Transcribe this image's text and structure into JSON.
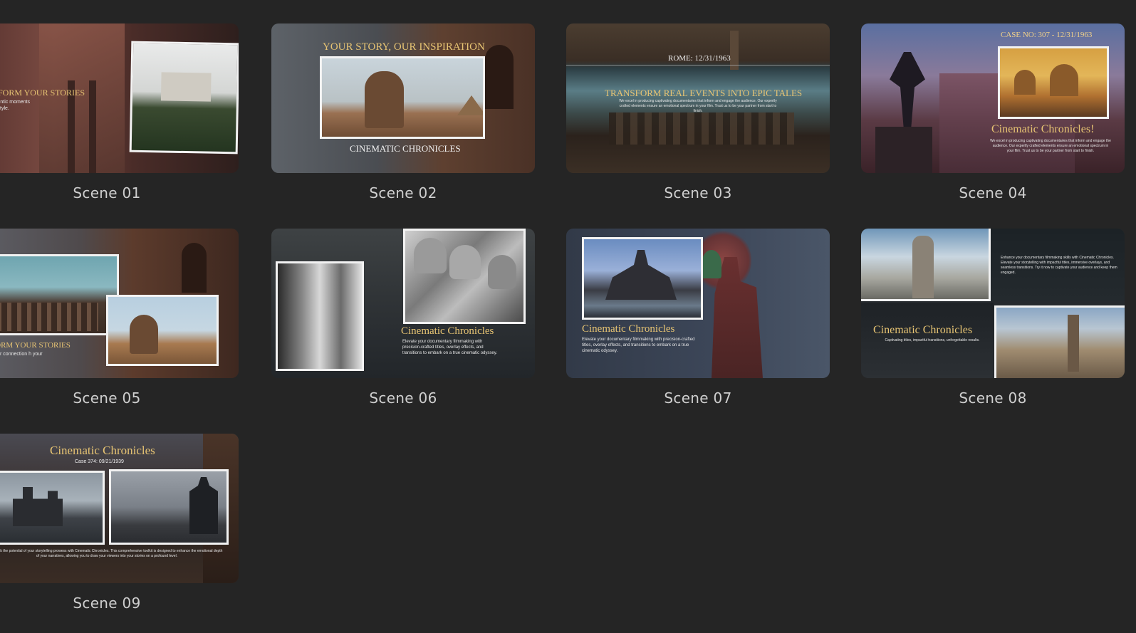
{
  "scenes": [
    {
      "label": "Scene 01",
      "heading": "RANSFORM YOUR STORIES",
      "body": "pture authentic moments cinematic style."
    },
    {
      "label": "Scene 02",
      "heading": "YOUR STORY, OUR INSPIRATION",
      "caption": "CINEMATIC CHRONICLES"
    },
    {
      "label": "Scene 03",
      "caption": "ROME: 12/31/1963",
      "heading": "TRANSFORM REAL EVENTS INTO EPIC TALES",
      "body": "We excel in producing captivating documentaries that inform and engage the audience. Our expertly crafted elements ensure an emotional spectrum in your film. Trust us to be your partner from start to finish."
    },
    {
      "label": "Scene 04",
      "caption": "CASE NO: 307 - 12/31/1963",
      "heading": "Cinematic Chronicles!",
      "body": "We excel in producing captivating documentaries that inform and engage the audience. Our expertly crafted elements ensure an emotional spectrum in your film. Trust us to be your partner from start to finish."
    },
    {
      "label": "Scene 05",
      "heading": "ANSFORM YOUR STORIES",
      "body": "ge a deeper connection h your audience."
    },
    {
      "label": "Scene 06",
      "heading": "Cinematic Chronicles",
      "body": "Elevate your documentary filmmaking with precision-crafted titles, overlay effects, and transitions to embark on a true cinematic odyssey."
    },
    {
      "label": "Scene 07",
      "heading": "Cinematic Chronicles",
      "body": "Elevate your documentary filmmaking with precision-crafted titles, overlay effects, and transitions to embark on a true cinematic odyssey."
    },
    {
      "label": "Scene 08",
      "heading": "Cinematic Chronicles",
      "subtext": "Captivating titles, impactful transitions, unforgettable results.",
      "body": "Enhance your documentary filmmaking skills with Cinematic Chronicles. Elevate your storytelling with impactful titles, immersive overlays, and seamless transitions. Try it now to captivate your audience and keep them engaged."
    },
    {
      "label": "Scene 09",
      "heading": "Cinematic Chronicles",
      "caption": "Case 374: 09/21/1939",
      "body": "Unlock the potential of your storytelling prowess with Cinematic Chronicles. This comprehensive toolkit is designed to enhance the emotional depth of your narratives, allowing you to draw your viewers into your stories on a profound level."
    }
  ]
}
